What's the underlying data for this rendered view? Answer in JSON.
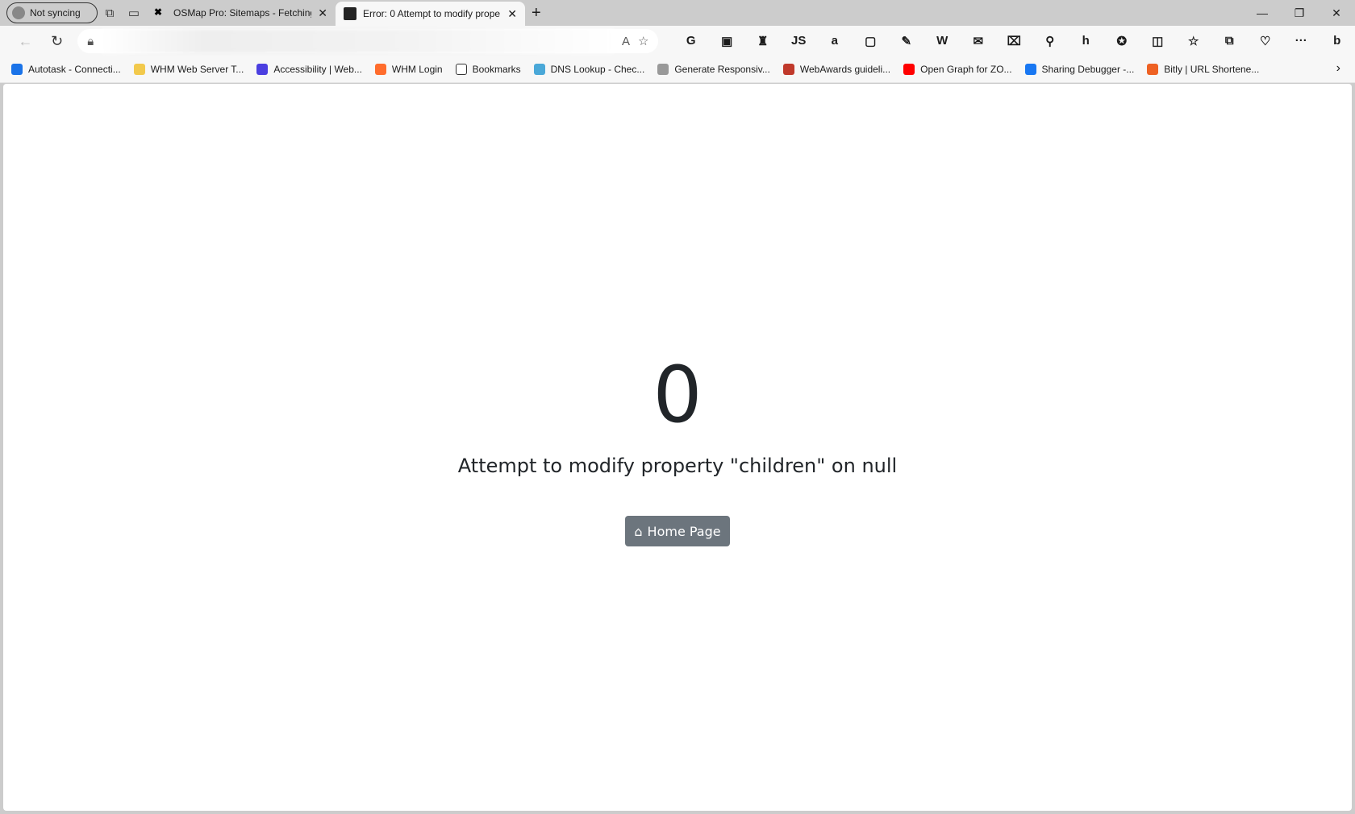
{
  "browser": {
    "profile_label": "Not syncing",
    "tabs": [
      {
        "title": "OSMap Pro: Sitemaps - Fetching",
        "active": false
      },
      {
        "title": "Error: 0 Attempt to modify prope",
        "active": true
      }
    ],
    "extensions": [
      "G",
      "▣",
      "♜",
      "JS",
      "a",
      "▢",
      "✎",
      "W",
      "✉",
      "⌧",
      "⚲",
      "h",
      "✪",
      "◫",
      "☆",
      "⧉",
      "♡",
      "···",
      "b"
    ],
    "bookmarks": [
      {
        "label": "Autotask - Connecti...",
        "color": "#1a73e8"
      },
      {
        "label": "WHM Web Server T...",
        "color": "#f2c94c"
      },
      {
        "label": "Accessibility  |  Web...",
        "color": "#4b3fe0"
      },
      {
        "label": "WHM Login",
        "color": "#ff6c2c"
      },
      {
        "label": "Bookmarks",
        "color": "#ffffff"
      },
      {
        "label": "DNS Lookup - Chec...",
        "color": "#4aa8d8"
      },
      {
        "label": "Generate Responsiv...",
        "color": "#999999"
      },
      {
        "label": "WebAwards guideli...",
        "color": "#c0392b"
      },
      {
        "label": "Open Graph for ZO...",
        "color": "#ff0000"
      },
      {
        "label": "Sharing Debugger -...",
        "color": "#1877f2"
      },
      {
        "label": "Bitly | URL Shortene...",
        "color": "#ee6123"
      }
    ]
  },
  "page": {
    "error_code": "0",
    "message": "Attempt to modify property \"children\" on null",
    "home_button_label": "Home Page",
    "button_color": "#6c757d"
  }
}
